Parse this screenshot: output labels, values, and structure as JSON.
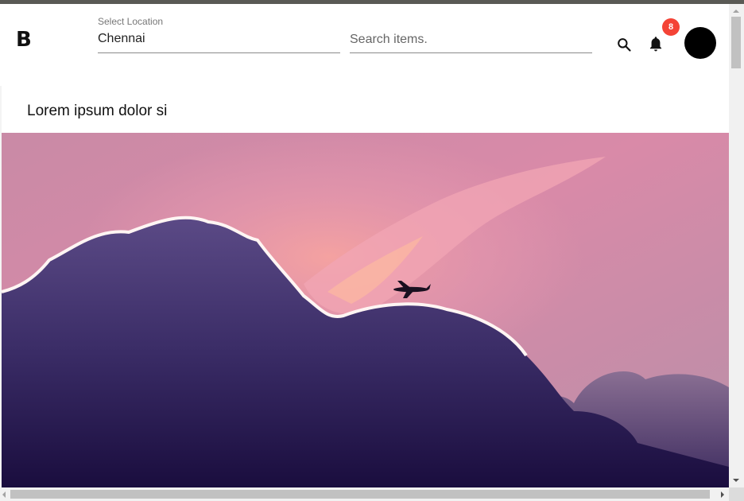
{
  "header": {
    "logo": "B",
    "location": {
      "label": "Select Location",
      "value": "Chennai"
    },
    "search": {
      "placeholder": "Search items."
    },
    "notifications": {
      "count": "8"
    },
    "icons": [
      "search-icon",
      "bell-icon",
      "avatar"
    ]
  },
  "card": {
    "title": "Lorem ipsum dolor si",
    "image": {
      "description_icon": "sky-photo"
    }
  },
  "colors": {
    "badge": "#f44336",
    "avatar": "#000000",
    "header_bg": "#ffffff"
  }
}
